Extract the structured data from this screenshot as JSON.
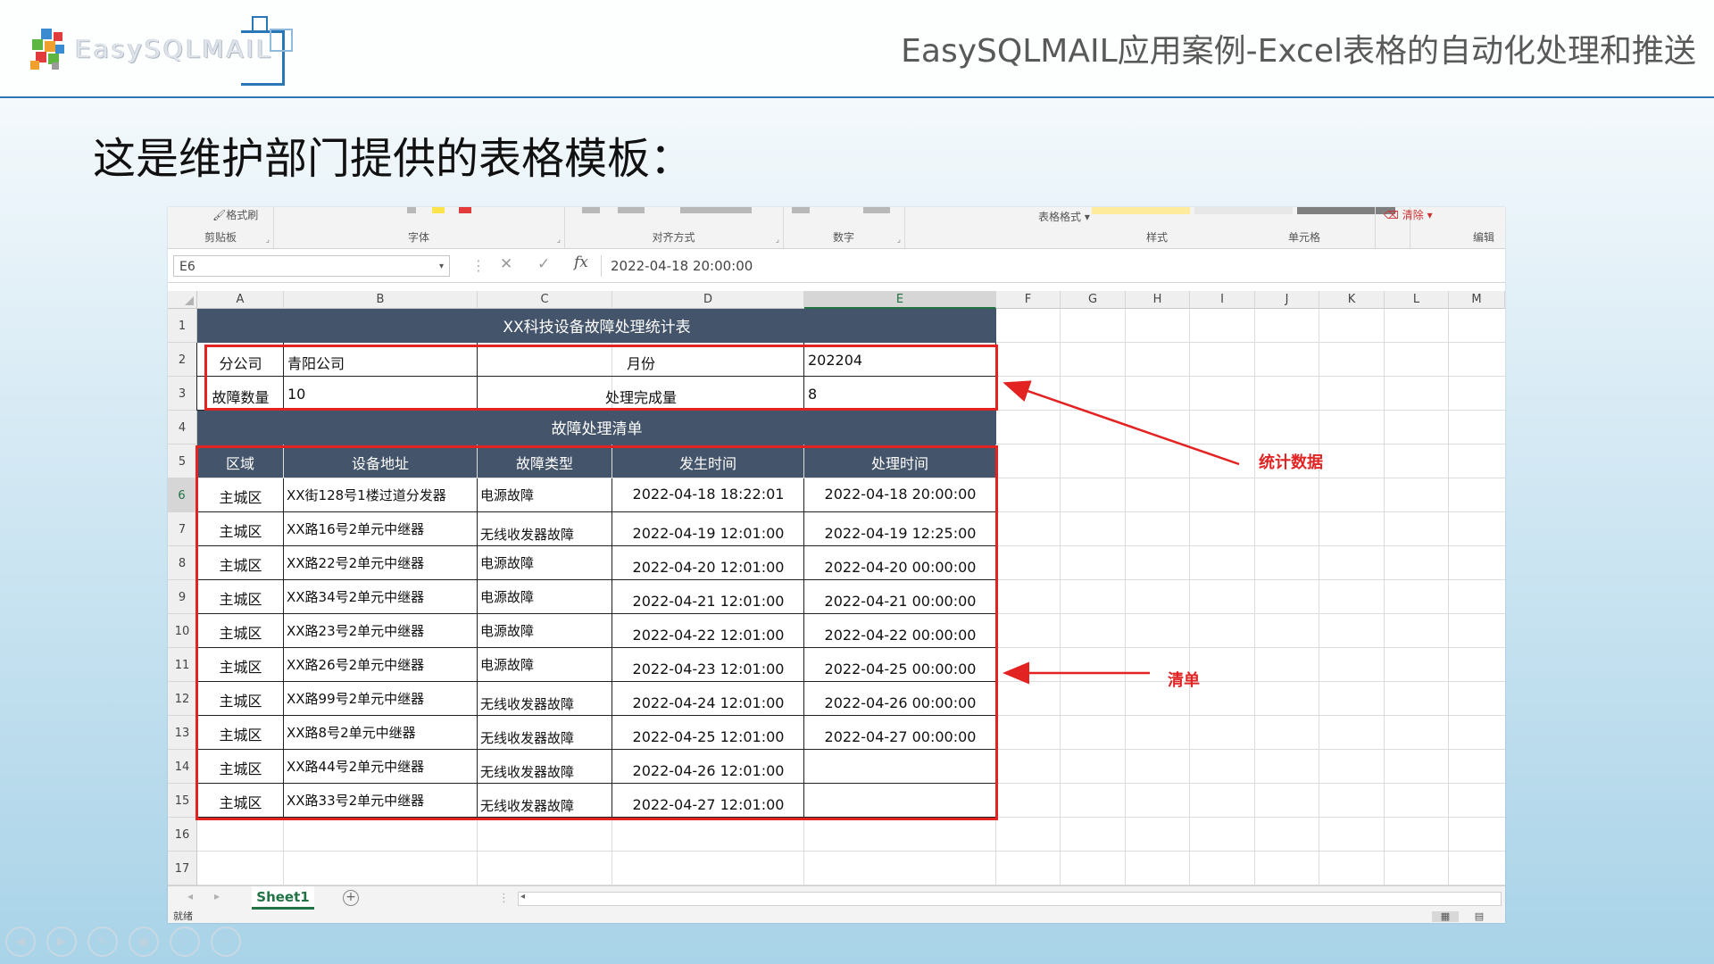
{
  "header": {
    "logo_text": "EasySQLMAIL",
    "slide_title": "EasySQLMAIL应用案例-Excel表格的自动化处理和推送"
  },
  "heading": "这是维护部门提供的表格模板：",
  "excel": {
    "ribbon": {
      "format_painter": "格式刷",
      "groups": [
        "剪贴板",
        "字体",
        "对齐方式",
        "数字",
        "样式",
        "单元格",
        "编辑"
      ],
      "table_format": "表格格式",
      "clear": "清除"
    },
    "formula_bar": {
      "name_box": "E6",
      "fx": "fx",
      "value": "2022-04-18  20:00:00"
    },
    "columns": [
      "A",
      "B",
      "C",
      "D",
      "E",
      "F",
      "G",
      "H",
      "I",
      "J",
      "K",
      "L",
      "M"
    ],
    "selected_column": "E",
    "rows": [
      "1",
      "2",
      "3",
      "4",
      "5",
      "6",
      "7",
      "8",
      "9",
      "10",
      "11",
      "12",
      "13",
      "14",
      "15",
      "16",
      "17"
    ],
    "selected_row": "6",
    "sheet": {
      "title": "XX科技设备故障处理统计表",
      "summary": [
        [
          "分公司",
          "青阳公司",
          "月份",
          "202204"
        ],
        [
          "故障数量",
          "10",
          "处理完成量",
          "8"
        ]
      ],
      "list_title": "故障处理清单",
      "list_headers": [
        "区域",
        "设备地址",
        "故障类型",
        "发生时间",
        "处理时间"
      ],
      "list_rows": [
        [
          "主城区",
          "XX街128号1楼过道分发器",
          "电源故障",
          "2022-04-18 18:22:01",
          "2022-04-18 20:00:00"
        ],
        [
          "主城区",
          "XX路16号2单元中继器",
          "无线收发器故障",
          "2022-04-19 12:01:00",
          "2022-04-19 12:25:00"
        ],
        [
          "主城区",
          "XX路22号2单元中继器",
          "电源故障",
          "2022-04-20 12:01:00",
          "2022-04-20 00:00:00"
        ],
        [
          "主城区",
          "XX路34号2单元中继器",
          "电源故障",
          "2022-04-21 12:01:00",
          "2022-04-21 00:00:00"
        ],
        [
          "主城区",
          "XX路23号2单元中继器",
          "电源故障",
          "2022-04-22 12:01:00",
          "2022-04-22 00:00:00"
        ],
        [
          "主城区",
          "XX路26号2单元中继器",
          "电源故障",
          "2022-04-23 12:01:00",
          "2022-04-25 00:00:00"
        ],
        [
          "主城区",
          "XX路99号2单元中继器",
          "无线收发器故障",
          "2022-04-24 12:01:00",
          "2022-04-26 00:00:00"
        ],
        [
          "主城区",
          "XX路8号2单元中继器",
          "无线收发器故障",
          "2022-04-25 12:01:00",
          "2022-04-27 00:00:00"
        ],
        [
          "主城区",
          "XX路44号2单元中继器",
          "无线收发器故障",
          "2022-04-26 12:01:00",
          ""
        ],
        [
          "主城区",
          "XX路33号2单元中继器",
          "无线收发器故障",
          "2022-04-27 12:01:00",
          ""
        ]
      ]
    },
    "sheet_tab": "Sheet1",
    "add_sheet": "+",
    "status": "就绪"
  },
  "annotations": {
    "stats": "统计数据",
    "list": "清单"
  },
  "colors": {
    "banner": "#44546a",
    "annotation_red": "#e32222",
    "excel_green": "#217346",
    "rule_blue": "#2e75b6"
  },
  "controls": [
    "prev-icon",
    "next-icon",
    "pen-icon",
    "slides-icon",
    "zoom-icon",
    "more-icon"
  ]
}
